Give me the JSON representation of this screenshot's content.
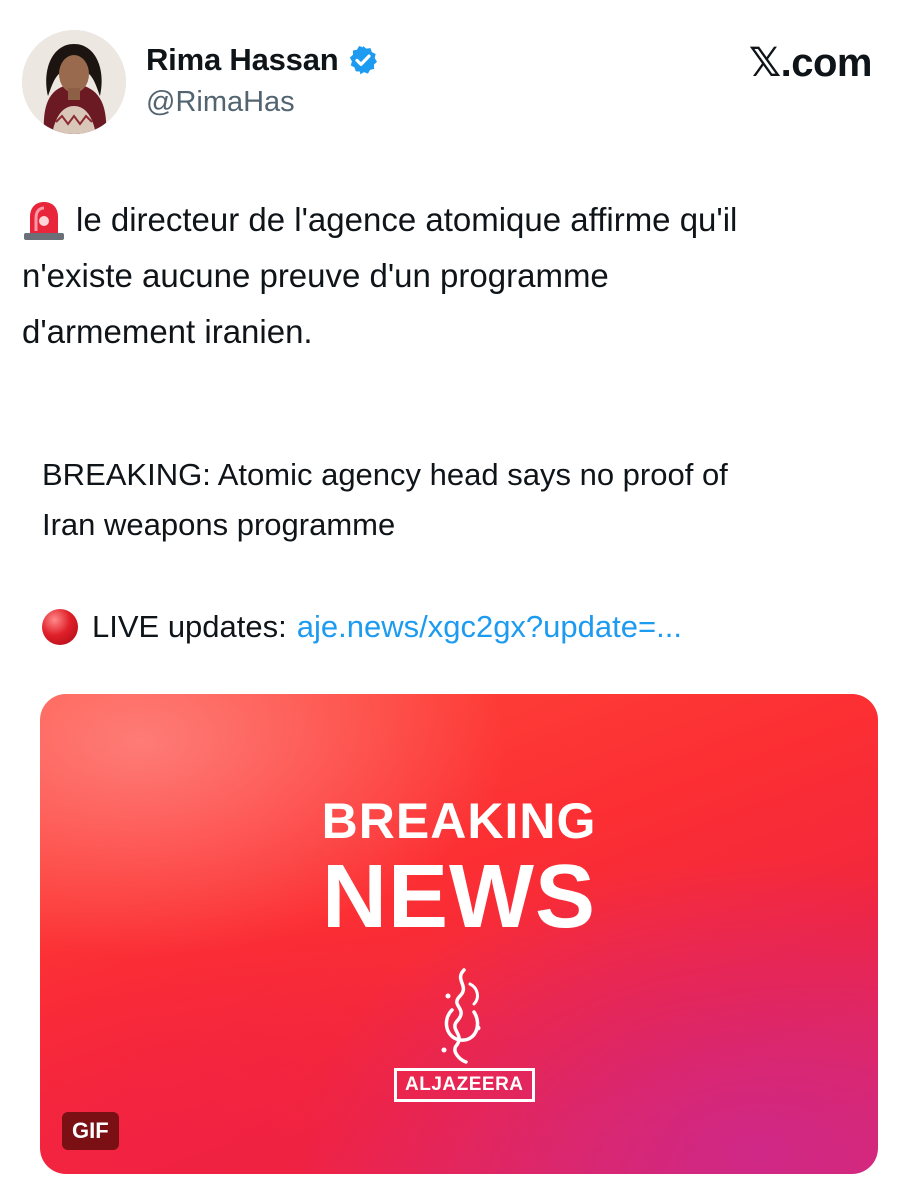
{
  "author": {
    "display_name": "Rima Hassan",
    "handle": "@RimaHas",
    "avatar_icon": "profile-photo",
    "verified_icon": "verified-badge-icon"
  },
  "brand": {
    "label": "𝕏.com"
  },
  "tweet": {
    "lead_icon": "siren-icon",
    "text": "le directeur de l'agence atomique affirme qu'il\nn'existe aucune preuve d'un programme\nd'armement iranien."
  },
  "quoted": {
    "headline": "BREAKING: Atomic agency head says no proof of\nIran weapons programme",
    "live_icon": "red-circle-icon",
    "live_label": "LIVE updates:",
    "live_link": "aje.news/xgc2gx?update=..."
  },
  "media": {
    "line1": "BREAKING",
    "line2": "NEWS",
    "logo_icon": "aljazeera-logo-icon",
    "wordmark": "ALJAZEERA",
    "badge": "GIF"
  },
  "colors": {
    "link": "#1d9bf0",
    "verified": "#1d9bf0",
    "media_red": "#fc2f33",
    "handle_gray": "#536471"
  }
}
